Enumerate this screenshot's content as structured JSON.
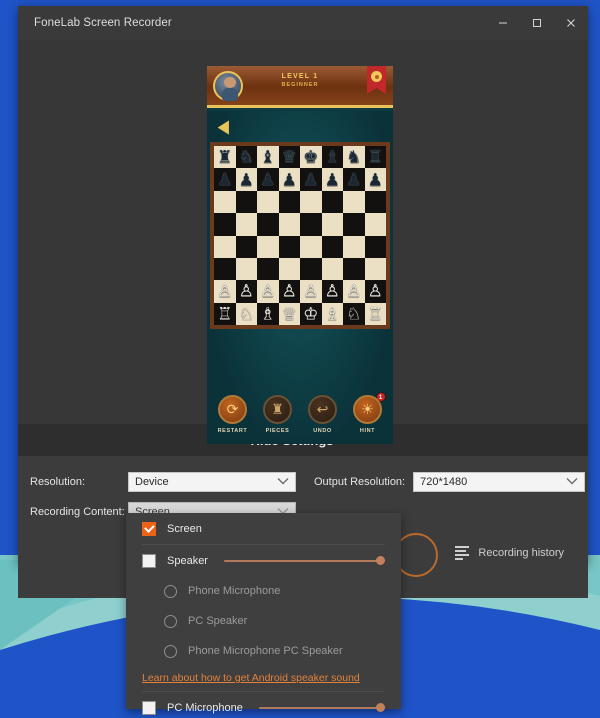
{
  "window": {
    "title": "FoneLab Screen Recorder",
    "controls": {
      "minimize": "minimize-icon",
      "maximize": "maximize-icon",
      "close": "close-icon"
    }
  },
  "phone": {
    "game": {
      "level_line1": "LEVEL 1",
      "level_line2": "BEGINNER",
      "gear": "gear-icon",
      "back": "◀",
      "controls": [
        {
          "label": "RESTART",
          "icon": "⟳",
          "style": "hot",
          "badge": ""
        },
        {
          "label": "PIECES",
          "icon": "♜",
          "style": "dim",
          "badge": ""
        },
        {
          "label": "UNDO",
          "icon": "↩",
          "style": "dim",
          "badge": ""
        },
        {
          "label": "HINT",
          "icon": "☀",
          "style": "hot",
          "badge": "1"
        }
      ],
      "board": {
        "back_rank_black": [
          "♜",
          "♞",
          "♝",
          "♛",
          "♚",
          "♝",
          "♞",
          "♜"
        ],
        "pawn_black": "♟",
        "pawn_white": "♙",
        "back_rank_white": [
          "♖",
          "♘",
          "♗",
          "♕",
          "♔",
          "♗",
          "♘",
          "♖"
        ]
      }
    }
  },
  "settings_bar": {
    "label": "Hide Settings",
    "caret": "⌄"
  },
  "settings": {
    "resolution_label": "Resolution:",
    "resolution_value": "Device",
    "output_resolution_label": "Output Resolution:",
    "output_resolution_value": "720*1480",
    "recording_content_label": "Recording Content:",
    "recording_content_value": "Screen",
    "caret": "∨"
  },
  "recording_history": {
    "label": "Recording history",
    "icon": "list-icon"
  },
  "record_button": {
    "label": "record-button"
  },
  "dropdown": {
    "screen": {
      "label": "Screen",
      "checked": true
    },
    "speaker": {
      "label": "Speaker",
      "checked": false
    },
    "radios": [
      {
        "label": "Phone Microphone",
        "selected": false
      },
      {
        "label": "PC Speaker",
        "selected": false
      },
      {
        "label": "Phone Microphone  PC Speaker",
        "selected": false
      }
    ],
    "link": "Learn about how to get Android speaker sound",
    "pc_microphone": {
      "label": "PC Microphone",
      "checked": false
    }
  },
  "colors": {
    "accent_orange": "#ec6318",
    "link_orange": "#e3823c",
    "window_bg": "#373737",
    "panel_bg": "#3f3f3f",
    "desktop_blue": "#1f54c8",
    "desktop_teal": "#6cc0c0"
  }
}
